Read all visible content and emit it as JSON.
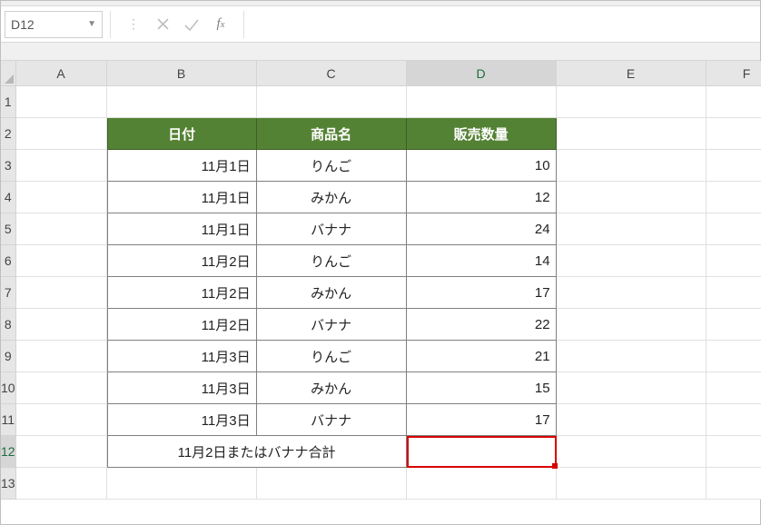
{
  "name_box": "D12",
  "formula_input": "",
  "colheaders": [
    "A",
    "B",
    "C",
    "D",
    "E",
    "F"
  ],
  "rownumbers": [
    "1",
    "2",
    "3",
    "4",
    "5",
    "6",
    "7",
    "8",
    "9",
    "10",
    "11",
    "12",
    "13"
  ],
  "active": {
    "col": "D",
    "row": "12"
  },
  "table": {
    "headers": {
      "b": "日付",
      "c": "商品名",
      "d": "販売数量"
    },
    "rows": [
      {
        "b": "11月1日",
        "c": "りんご",
        "d": "10"
      },
      {
        "b": "11月1日",
        "c": "みかん",
        "d": "12"
      },
      {
        "b": "11月1日",
        "c": "バナナ",
        "d": "24"
      },
      {
        "b": "11月2日",
        "c": "りんご",
        "d": "14"
      },
      {
        "b": "11月2日",
        "c": "みかん",
        "d": "17"
      },
      {
        "b": "11月2日",
        "c": "バナナ",
        "d": "22"
      },
      {
        "b": "11月3日",
        "c": "りんご",
        "d": "21"
      },
      {
        "b": "11月3日",
        "c": "みかん",
        "d": "15"
      },
      {
        "b": "11月3日",
        "c": "バナナ",
        "d": "17"
      }
    ],
    "footer": {
      "label": "11月2日またはバナナ合計",
      "value": ""
    }
  },
  "chart_data": {
    "type": "table",
    "title": "",
    "columns": [
      "日付",
      "商品名",
      "販売数量"
    ],
    "rows": [
      [
        "11月1日",
        "りんご",
        10
      ],
      [
        "11月1日",
        "みかん",
        12
      ],
      [
        "11月1日",
        "バナナ",
        24
      ],
      [
        "11月2日",
        "りんご",
        14
      ],
      [
        "11月2日",
        "みかん",
        17
      ],
      [
        "11月2日",
        "バナナ",
        22
      ],
      [
        "11月3日",
        "りんご",
        21
      ],
      [
        "11月3日",
        "みかん",
        15
      ],
      [
        "11月3日",
        "バナナ",
        17
      ]
    ],
    "footer": {
      "label": "11月2日またはバナナ合計",
      "value": null
    }
  }
}
